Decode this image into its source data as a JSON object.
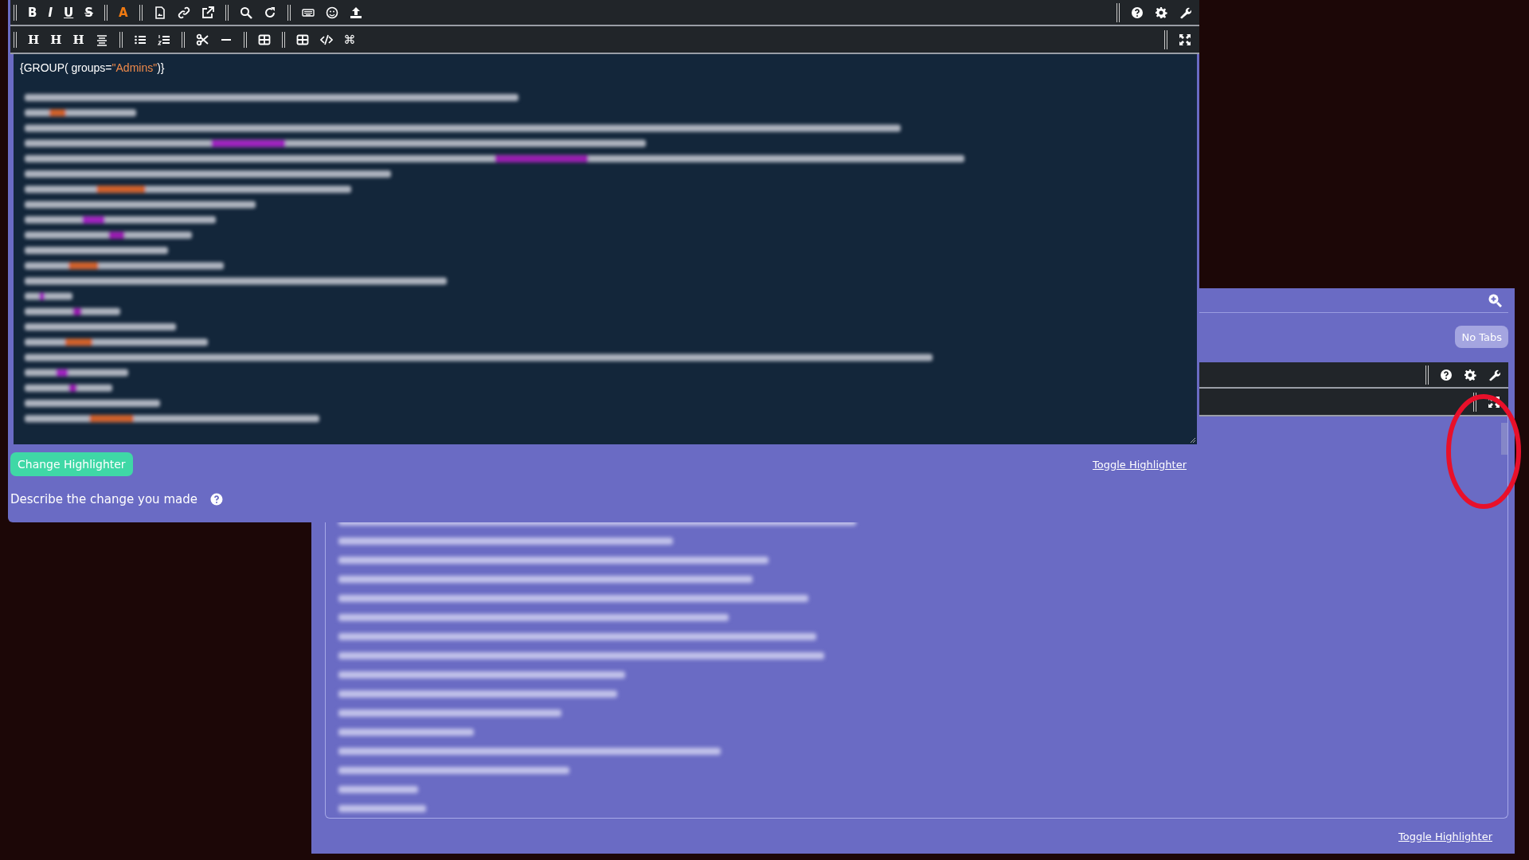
{
  "front_editor": {
    "format_buttons": [
      "B",
      "I",
      "U",
      "S"
    ],
    "color_button": "A",
    "heading_buttons": [
      "H",
      "H",
      "H"
    ],
    "command_button": "⌘",
    "code_line": [
      {
        "text": "{GROUP( groups=",
        "kind": "plain"
      },
      {
        "text": "\"Admins\"",
        "kind": "string"
      },
      {
        "text": ")}",
        "kind": "plain"
      }
    ],
    "change_button": "Change Highlighter",
    "toggle_link": "Toggle Highlighter",
    "describe_label": "Describe the change you made"
  },
  "back_editor": {
    "tabs_button": "No Tabs",
    "toggle_link": "Toggle Highlighter"
  }
}
